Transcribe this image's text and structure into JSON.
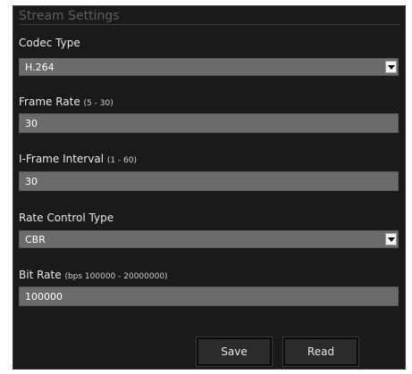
{
  "panel": {
    "title": "Stream Settings"
  },
  "fields": {
    "codec_type": {
      "label": "Codec Type",
      "value": "H.264"
    },
    "frame_rate": {
      "label": "Frame Rate",
      "range": "(5 - 30)",
      "value": "30"
    },
    "iframe_interval": {
      "label": "I-Frame Interval",
      "range": "(1 - 60)",
      "value": "30"
    },
    "rate_control_type": {
      "label": "Rate Control Type",
      "value": "CBR"
    },
    "bit_rate": {
      "label": "Bit Rate",
      "range": "(bps 100000 - 20000000)",
      "value": "100000"
    }
  },
  "buttons": {
    "save": "Save",
    "read": "Read"
  },
  "colors": {
    "panel_background": "#1a1a1a",
    "field_background": "#6b6b6b",
    "title_text": "#5e5e5e"
  }
}
